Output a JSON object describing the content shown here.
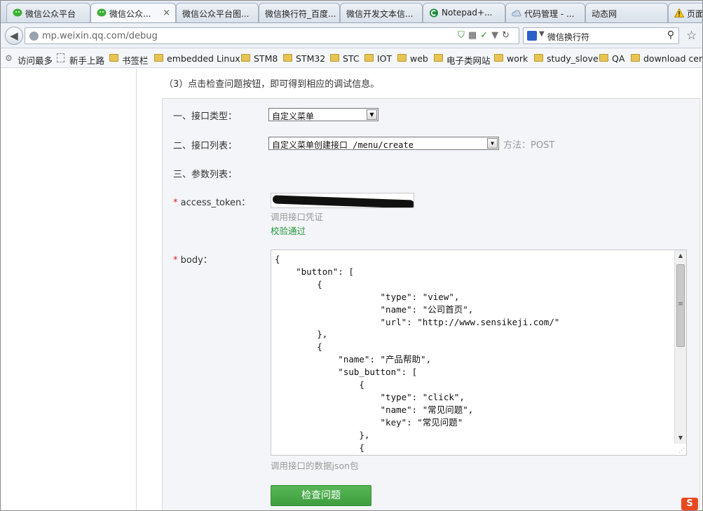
{
  "browser": {
    "tabs": [
      {
        "title": "微信公众平台",
        "icon": "wechat-icon"
      },
      {
        "title": "微信公众...",
        "icon": "wechat-icon",
        "active": true
      },
      {
        "title": "微信公众平台图..."
      },
      {
        "title": "微信换行符_百度..."
      },
      {
        "title": "微信开发文本信..."
      },
      {
        "title": "Notepad+...",
        "icon": "notepad-icon"
      },
      {
        "title": "代码管理 - ...",
        "icon": "cloud-icon"
      },
      {
        "title": "动态网"
      },
      {
        "title": "页面",
        "icon": "warning-icon"
      }
    ],
    "tab_close_glyph": "×",
    "url": "mp.weixin.qq.com/debug",
    "search_engine_icon": "baidu-paw-icon",
    "search_text": "微信换行符",
    "bookmarks": [
      {
        "label": "访问最多",
        "icon": "gear-icon"
      },
      {
        "label": "新手上路",
        "icon": "page-icon"
      },
      {
        "label": "书签栏",
        "icon": "folder-icon"
      },
      {
        "label": "embedded Linux",
        "icon": "folder-icon"
      },
      {
        "label": "STM8",
        "icon": "folder-icon"
      },
      {
        "label": "STM32",
        "icon": "folder-icon"
      },
      {
        "label": "STC",
        "icon": "folder-icon"
      },
      {
        "label": "IOT",
        "icon": "folder-icon"
      },
      {
        "label": "web",
        "icon": "folder-icon"
      },
      {
        "label": "电子类网站",
        "icon": "folder-icon"
      },
      {
        "label": "work",
        "icon": "folder-icon"
      },
      {
        "label": "study_slove",
        "icon": "folder-icon"
      },
      {
        "label": "QA",
        "icon": "folder-icon"
      },
      {
        "label": "download cen",
        "icon": "folder-icon"
      }
    ]
  },
  "page": {
    "hint": "（3）点击检查问题按钮，即可得到相应的调试信息。",
    "interface_type_label": "一、接口类型：",
    "interface_type_value": "自定义菜单",
    "interface_list_label": "二、接口列表：",
    "interface_list_value": "自定义菜单创建接口 /menu/create",
    "method_text": "方法：POST",
    "params_label": "三、参数列表：",
    "required_mark": "*",
    "access_token_label": "access_token：",
    "access_token_help": "调用接口凭证",
    "access_token_status": "校验通过",
    "body_label": "body：",
    "body_code": "{\n    \"button\": [\n        {\n                    \"type\": \"view\",\n                    \"name\": \"公司首页\",\n                    \"url\": \"http://www.sensikeji.com/\"\n        },\n        {\n            \"name\": \"产品帮助\",\n            \"sub_button\": [\n                {\n                    \"type\": \"click\",\n                    \"name\": \"常见问题\",\n                    \"key\": \"常见问题\"\n                },\n                {",
    "body_help": "调用接口的数据json包",
    "check_button": "检查问题",
    "badge_text": "S"
  },
  "colors": {
    "accent_green": "#44a543",
    "required_red": "#d22222",
    "status_green": "#23993a"
  }
}
